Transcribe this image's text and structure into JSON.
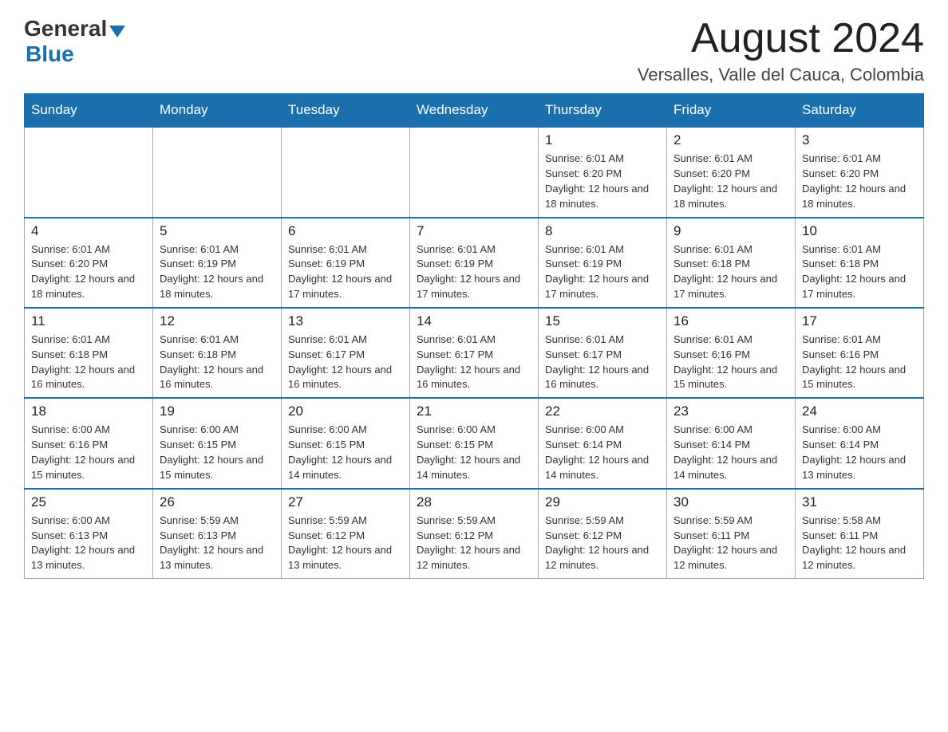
{
  "header": {
    "logo_general": "General",
    "logo_blue": "Blue",
    "month_title": "August 2024",
    "subtitle": "Versalles, Valle del Cauca, Colombia"
  },
  "days_of_week": [
    "Sunday",
    "Monday",
    "Tuesday",
    "Wednesday",
    "Thursday",
    "Friday",
    "Saturday"
  ],
  "weeks": [
    [
      {
        "day": "",
        "info": ""
      },
      {
        "day": "",
        "info": ""
      },
      {
        "day": "",
        "info": ""
      },
      {
        "day": "",
        "info": ""
      },
      {
        "day": "1",
        "info": "Sunrise: 6:01 AM\nSunset: 6:20 PM\nDaylight: 12 hours and 18 minutes."
      },
      {
        "day": "2",
        "info": "Sunrise: 6:01 AM\nSunset: 6:20 PM\nDaylight: 12 hours and 18 minutes."
      },
      {
        "day": "3",
        "info": "Sunrise: 6:01 AM\nSunset: 6:20 PM\nDaylight: 12 hours and 18 minutes."
      }
    ],
    [
      {
        "day": "4",
        "info": "Sunrise: 6:01 AM\nSunset: 6:20 PM\nDaylight: 12 hours and 18 minutes."
      },
      {
        "day": "5",
        "info": "Sunrise: 6:01 AM\nSunset: 6:19 PM\nDaylight: 12 hours and 18 minutes."
      },
      {
        "day": "6",
        "info": "Sunrise: 6:01 AM\nSunset: 6:19 PM\nDaylight: 12 hours and 17 minutes."
      },
      {
        "day": "7",
        "info": "Sunrise: 6:01 AM\nSunset: 6:19 PM\nDaylight: 12 hours and 17 minutes."
      },
      {
        "day": "8",
        "info": "Sunrise: 6:01 AM\nSunset: 6:19 PM\nDaylight: 12 hours and 17 minutes."
      },
      {
        "day": "9",
        "info": "Sunrise: 6:01 AM\nSunset: 6:18 PM\nDaylight: 12 hours and 17 minutes."
      },
      {
        "day": "10",
        "info": "Sunrise: 6:01 AM\nSunset: 6:18 PM\nDaylight: 12 hours and 17 minutes."
      }
    ],
    [
      {
        "day": "11",
        "info": "Sunrise: 6:01 AM\nSunset: 6:18 PM\nDaylight: 12 hours and 16 minutes."
      },
      {
        "day": "12",
        "info": "Sunrise: 6:01 AM\nSunset: 6:18 PM\nDaylight: 12 hours and 16 minutes."
      },
      {
        "day": "13",
        "info": "Sunrise: 6:01 AM\nSunset: 6:17 PM\nDaylight: 12 hours and 16 minutes."
      },
      {
        "day": "14",
        "info": "Sunrise: 6:01 AM\nSunset: 6:17 PM\nDaylight: 12 hours and 16 minutes."
      },
      {
        "day": "15",
        "info": "Sunrise: 6:01 AM\nSunset: 6:17 PM\nDaylight: 12 hours and 16 minutes."
      },
      {
        "day": "16",
        "info": "Sunrise: 6:01 AM\nSunset: 6:16 PM\nDaylight: 12 hours and 15 minutes."
      },
      {
        "day": "17",
        "info": "Sunrise: 6:01 AM\nSunset: 6:16 PM\nDaylight: 12 hours and 15 minutes."
      }
    ],
    [
      {
        "day": "18",
        "info": "Sunrise: 6:00 AM\nSunset: 6:16 PM\nDaylight: 12 hours and 15 minutes."
      },
      {
        "day": "19",
        "info": "Sunrise: 6:00 AM\nSunset: 6:15 PM\nDaylight: 12 hours and 15 minutes."
      },
      {
        "day": "20",
        "info": "Sunrise: 6:00 AM\nSunset: 6:15 PM\nDaylight: 12 hours and 14 minutes."
      },
      {
        "day": "21",
        "info": "Sunrise: 6:00 AM\nSunset: 6:15 PM\nDaylight: 12 hours and 14 minutes."
      },
      {
        "day": "22",
        "info": "Sunrise: 6:00 AM\nSunset: 6:14 PM\nDaylight: 12 hours and 14 minutes."
      },
      {
        "day": "23",
        "info": "Sunrise: 6:00 AM\nSunset: 6:14 PM\nDaylight: 12 hours and 14 minutes."
      },
      {
        "day": "24",
        "info": "Sunrise: 6:00 AM\nSunset: 6:14 PM\nDaylight: 12 hours and 13 minutes."
      }
    ],
    [
      {
        "day": "25",
        "info": "Sunrise: 6:00 AM\nSunset: 6:13 PM\nDaylight: 12 hours and 13 minutes."
      },
      {
        "day": "26",
        "info": "Sunrise: 5:59 AM\nSunset: 6:13 PM\nDaylight: 12 hours and 13 minutes."
      },
      {
        "day": "27",
        "info": "Sunrise: 5:59 AM\nSunset: 6:12 PM\nDaylight: 12 hours and 13 minutes."
      },
      {
        "day": "28",
        "info": "Sunrise: 5:59 AM\nSunset: 6:12 PM\nDaylight: 12 hours and 12 minutes."
      },
      {
        "day": "29",
        "info": "Sunrise: 5:59 AM\nSunset: 6:12 PM\nDaylight: 12 hours and 12 minutes."
      },
      {
        "day": "30",
        "info": "Sunrise: 5:59 AM\nSunset: 6:11 PM\nDaylight: 12 hours and 12 minutes."
      },
      {
        "day": "31",
        "info": "Sunrise: 5:58 AM\nSunset: 6:11 PM\nDaylight: 12 hours and 12 minutes."
      }
    ]
  ]
}
